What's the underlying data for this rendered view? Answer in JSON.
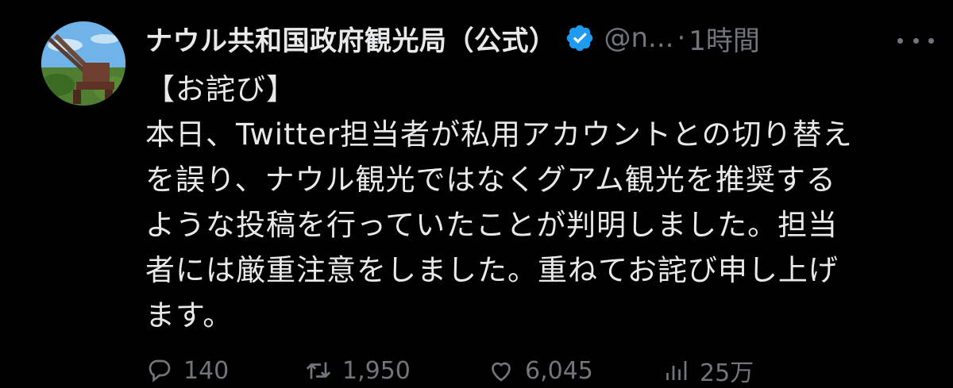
{
  "tweet": {
    "display_name": "ナウル共和国政府観光局（公式）",
    "handle": "@n...",
    "separator": "·",
    "time": "1時間",
    "lines": [
      "【お詫び】",
      "本日、Twitter担当者が私用アカウントとの切り替え",
      "を誤り、ナウル観光ではなくグアム観光を推奨する",
      "ような投稿を行っていたことが判明しました。担当",
      "者には厳重注意をしました。重ねてお詫び申し上げ",
      "ます。"
    ],
    "actions": {
      "reply_count": "140",
      "retweet_count": "1,950",
      "like_count": "6,045",
      "view_count": "25万"
    }
  },
  "colors": {
    "background": "#000000",
    "text": "#e7e9ea",
    "muted": "#71767b",
    "verified": "#1d9bf0"
  },
  "icons": [
    "avatar-image",
    "verified-badge-icon",
    "more-options-icon",
    "reply-icon",
    "retweet-icon",
    "like-icon",
    "views-icon"
  ]
}
